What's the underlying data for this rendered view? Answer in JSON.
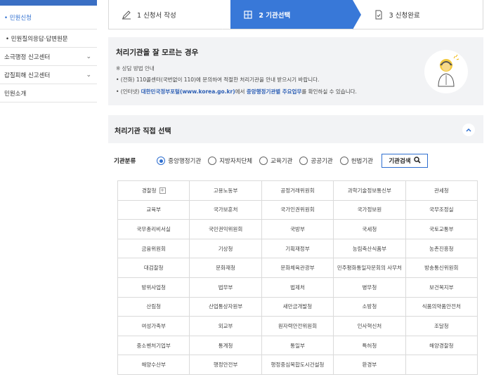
{
  "sidebar": {
    "items": [
      {
        "label": "• 민원신청",
        "active": true
      },
      {
        "label": "• 민원질의응답·답변원문",
        "active": false
      },
      {
        "label": "소극행정 신고센터",
        "chevron": "chevron-down-icon"
      },
      {
        "label": "갑질피해 신고센터",
        "chevron": "chevron-down-icon"
      },
      {
        "label": "민원소개"
      }
    ]
  },
  "steps": [
    {
      "label": "1 신청서 작성",
      "icon": "pencil-icon"
    },
    {
      "label": "2 기관선택",
      "icon": "building-icon"
    },
    {
      "label": "3 신청완료",
      "icon": "document-icon"
    }
  ],
  "info": {
    "title": "처리기관을 잘 모르는 경우",
    "subtitle": "※ 상담 방법 안내",
    "line1": "• (전화) 110콜센터(국번없이 110)에 문의하여 적절한 처리기관을 안내 받으시기 바랍니다.",
    "line2_prefix": "• (인터넷) ",
    "line2_link1": "대한민국정부포털(www.korea.go.kr)",
    "line2_mid": "에서 ",
    "line2_link2": "중앙행정기관별 주요업무",
    "line2_suffix": "를 확인하실 수 있습니다."
  },
  "section": {
    "title": "처리기관 직접 선택"
  },
  "filter": {
    "label": "기관분류",
    "options": [
      "중앙행정기관",
      "지방자치단체",
      "교육기관",
      "공공기관",
      "헌법기관"
    ],
    "selected": "중앙행정기관",
    "search_label": "기관검색"
  },
  "agencies": [
    "경찰청",
    "고용노동부",
    "공정거래위원회",
    "과학기술정보통신부",
    "관세청",
    "교육부",
    "국가보훈처",
    "국가인권위원회",
    "국가정보원",
    "국무조정실",
    "국무총리비서실",
    "국민권익위원회",
    "국방부",
    "국세청",
    "국토교통부",
    "금융위원회",
    "기상청",
    "기획재정부",
    "농림축산식품부",
    "농촌진흥청",
    "대검찰청",
    "문화재청",
    "문화체육관광부",
    "민주평화통일자문회의 사무처",
    "방송통신위원회",
    "방위사업청",
    "법무부",
    "법제처",
    "병무청",
    "보건복지부",
    "산림청",
    "산업통상자원부",
    "새만금개발청",
    "소방청",
    "식품의약품안전처",
    "여성가족부",
    "외교부",
    "원자력안전위원회",
    "인사혁신처",
    "조달청",
    "중소벤처기업부",
    "통계청",
    "통일부",
    "특허청",
    "해양경찰청",
    "해양수산부",
    "행정안전부",
    "행정중심복합도시건설청",
    "환경부",
    ""
  ],
  "colors": {
    "accent": "#3878d8",
    "panel": "#f2f3f5",
    "link": "#2d5fb5"
  }
}
